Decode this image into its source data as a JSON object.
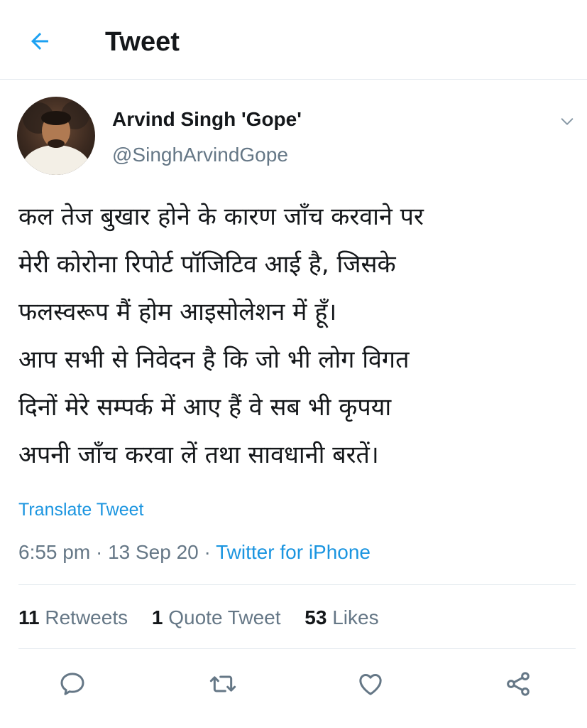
{
  "header": {
    "title": "Tweet",
    "back_icon": "arrow-left-icon",
    "accent": "#1da1f2"
  },
  "author": {
    "name": "Arvind Singh 'Gope'",
    "handle": "@SinghArvindGope",
    "menu_icon": "chevron-down-icon"
  },
  "tweet": {
    "lines": [
      "कल तेज बुखार होने के कारण जाँच करवाने पर",
      "मेरी कोरोना रिपोर्ट पॉजिटिव आई है, जिसके",
      "फलस्वरूप मैं होम आइसोलेशन में हूँ।",
      "आप सभी से निवेदन है कि जो भी लोग विगत",
      "दिनों मेरे सम्पर्क में आए हैं वे सब भी कृपया",
      "अपनी जाँच करवा लें तथा सावधानी बरतें।"
    ],
    "translate_label": "Translate Tweet",
    "time": "6:55 pm",
    "date": "13 Sep 20",
    "separator": "·",
    "source": "Twitter for iPhone"
  },
  "stats": {
    "retweets_count": "11",
    "retweets_label": "Retweets",
    "quotes_count": "1",
    "quotes_label": "Quote Tweet",
    "likes_count": "53",
    "likes_label": "Likes"
  },
  "actions": [
    "reply-icon",
    "retweet-icon",
    "like-icon",
    "share-icon"
  ],
  "colors": {
    "link": "#1b95e0",
    "secondary_text": "#657786",
    "primary_text": "#14171a",
    "divider": "#e1e8ed"
  }
}
